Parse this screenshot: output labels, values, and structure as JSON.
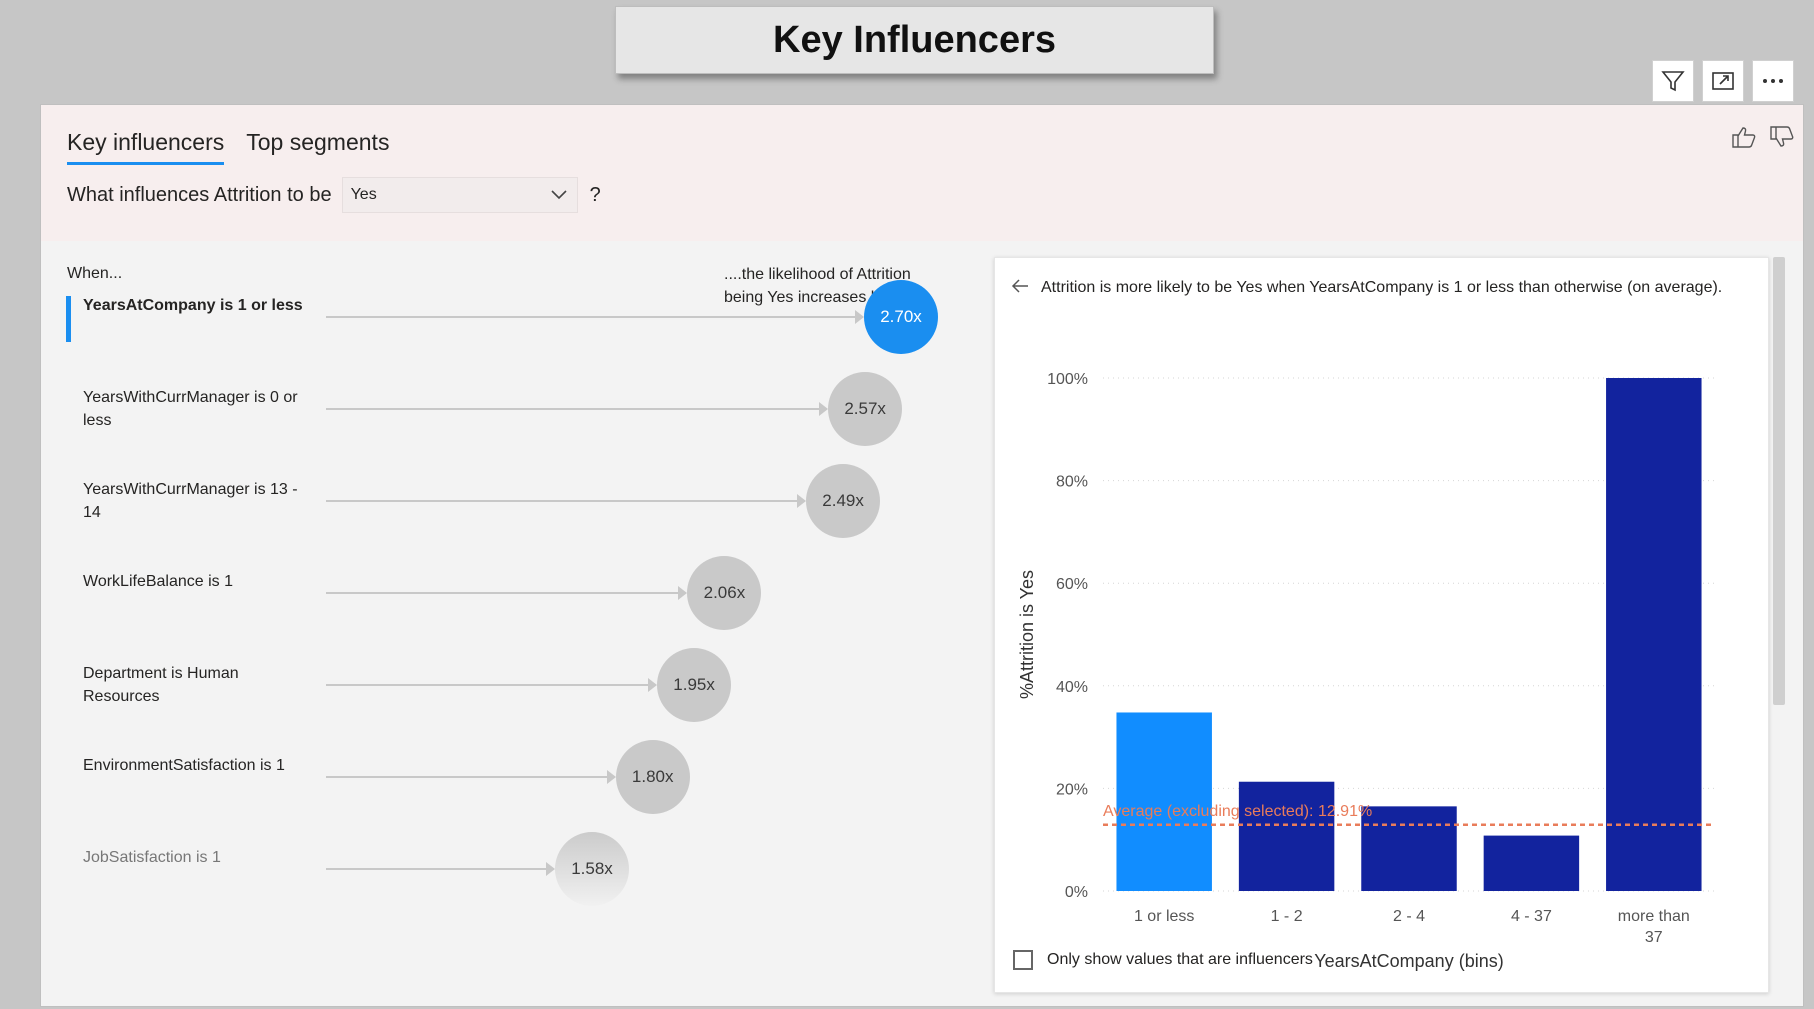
{
  "page": {
    "title": "Key Influencers"
  },
  "visual_header": {
    "icons": [
      "filter-icon",
      "focus-mode-icon",
      "more-options-icon"
    ]
  },
  "tabs": [
    {
      "label": "Key influencers",
      "active": true
    },
    {
      "label": "Top segments",
      "active": false
    }
  ],
  "feedback": {
    "icons": [
      "thumbs-up-icon",
      "thumbs-down-icon"
    ]
  },
  "question": {
    "prefix": "What influences Attrition to be",
    "selected_value": "Yes",
    "suffix": "?"
  },
  "columns": {
    "when": "When...",
    "likelihood": "....the likelihood of Attrition being Yes increases by"
  },
  "influencers": [
    {
      "label": "YearsAtCompany is 1 or less",
      "value": "2.70x",
      "multiplier": 2.7,
      "selected": true
    },
    {
      "label": "YearsWithCurrManager is 0 or less",
      "value": "2.57x",
      "multiplier": 2.57
    },
    {
      "label": "YearsWithCurrManager is 13 - 14",
      "value": "2.49x",
      "multiplier": 2.49
    },
    {
      "label": "WorkLifeBalance is 1",
      "value": "2.06x",
      "multiplier": 2.06
    },
    {
      "label": "Department is Human Resources",
      "value": "1.95x",
      "multiplier": 1.95
    },
    {
      "label": "EnvironmentSatisfaction is 1",
      "value": "1.80x",
      "multiplier": 1.8
    },
    {
      "label": "JobSatisfaction is 1",
      "value": "1.58x",
      "multiplier": 1.58,
      "faded": true
    }
  ],
  "detail": {
    "description": "Attrition is more likely to be Yes when YearsAtCompany is 1 or less than otherwise (on average).",
    "checkbox_label": "Only show values that are influencers",
    "checkbox_checked": false
  },
  "chart_data": {
    "type": "bar",
    "categories": [
      "1 or less",
      "1 - 2",
      "2 - 4",
      "4 - 37",
      "more than 37"
    ],
    "values": [
      34.8,
      21.3,
      16.5,
      10.8,
      100
    ],
    "highlighted_category": "1 or less",
    "colors": {
      "highlight": "#118dff",
      "default": "#12239e",
      "average_line": "#e97c5a"
    },
    "xlabel": "YearsAtCompany (bins)",
    "ylabel": "%Attrition is Yes",
    "ylim": [
      0,
      100
    ],
    "yticks": [
      "0%",
      "20%",
      "40%",
      "60%",
      "80%",
      "100%"
    ],
    "ytick_values": [
      0,
      20,
      40,
      60,
      80,
      100
    ],
    "average": {
      "label": "Average (excluding selected): 12.91%",
      "value": 12.91
    },
    "grid": true
  }
}
